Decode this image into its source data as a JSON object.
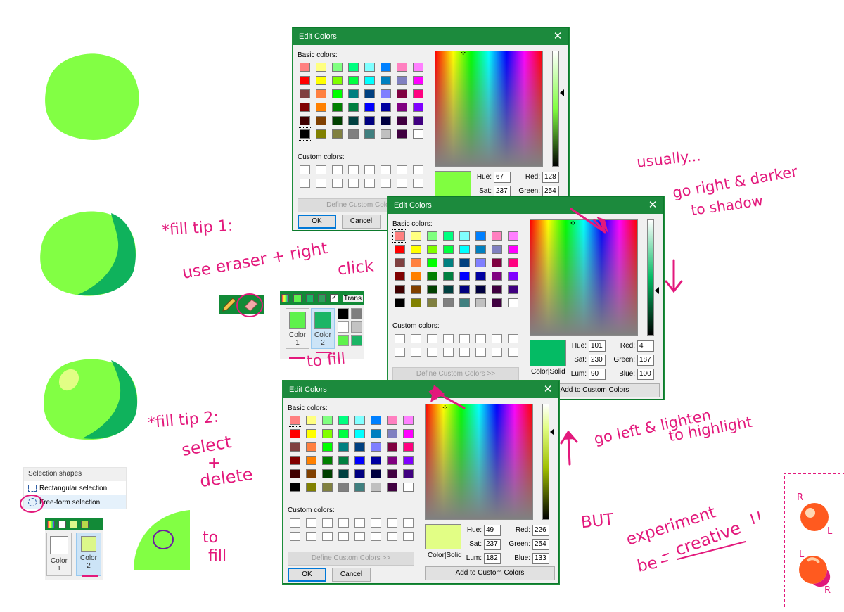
{
  "colors": {
    "basic": [
      "#ff8080",
      "#ffff80",
      "#80ff80",
      "#00ff80",
      "#80ffff",
      "#0080ff",
      "#ff80c0",
      "#ff80ff",
      "#ff0000",
      "#ffff00",
      "#80ff00",
      "#00ff40",
      "#00ffff",
      "#0080c0",
      "#8080c0",
      "#ff00ff",
      "#804040",
      "#ff8040",
      "#00ff00",
      "#008080",
      "#004080",
      "#8080ff",
      "#800040",
      "#ff0080",
      "#800000",
      "#ff8000",
      "#008000",
      "#008040",
      "#0000ff",
      "#0000a0",
      "#800080",
      "#8000ff",
      "#400000",
      "#804000",
      "#004000",
      "#004040",
      "#000080",
      "#000040",
      "#400040",
      "#400080",
      "#000000",
      "#808000",
      "#808040",
      "#808080",
      "#408080",
      "#c0c0c0",
      "#400040",
      "#ffffff"
    ]
  },
  "dialog1": {
    "title": "Edit Colors",
    "close": "✕",
    "basic_label": "Basic colors:",
    "custom_label": "Custom colors:",
    "define_btn": "Define Custom Colors",
    "ok": "OK",
    "cancel": "Cancel",
    "hue_label": "Hue:",
    "hue": "67",
    "sat_label": "Sat:",
    "sat": "237",
    "red_label": "Red:",
    "red": "128",
    "green_label": "Green:",
    "green": "254",
    "current_color": "#80fe40"
  },
  "dialog2": {
    "title": "Edit Colors",
    "close": "✕",
    "basic_label": "Basic colors:",
    "custom_label": "Custom colors:",
    "define_btn": "Define Custom Colors >>",
    "add_btn": "Add to Custom Colors",
    "hue_label": "Hue:",
    "hue": "101",
    "sat_label": "Sat:",
    "sat": "230",
    "lum_label": "Lum:",
    "lum": "90",
    "red_label": "Red:",
    "red": "4",
    "green_label": "Green:",
    "green": "187",
    "blue_label": "Blue:",
    "blue": "100",
    "color_solid": "Color|Solid",
    "current_color": "#04bb64"
  },
  "dialog3": {
    "title": "Edit Colors",
    "close": "✕",
    "basic_label": "Basic colors:",
    "custom_label": "Custom colors:",
    "define_btn": "Define Custom Colors >>",
    "add_btn": "Add to Custom Colors",
    "ok": "OK",
    "cancel": "Cancel",
    "hue_label": "Hue:",
    "hue": "49",
    "sat_label": "Sat:",
    "sat": "237",
    "lum_label": "Lum:",
    "lum": "182",
    "red_label": "Red:",
    "red": "226",
    "green_label": "Green:",
    "green": "254",
    "blue_label": "Blue:",
    "blue": "133",
    "color_solid": "Color|Solid",
    "current_color": "#e2fe85"
  },
  "palette_panel": {
    "transparent_label": "Trans",
    "color1_label": "Color 1",
    "color1_line1": "Color",
    "color1_line2": "1",
    "color2_line1": "Color",
    "color2_line2": "2",
    "color1": "#5ef24c",
    "color2": "#1bb565"
  },
  "selection_menu": {
    "title": "Selection shapes",
    "rect": "Rectangular selection",
    "freeform": "Free-form selection"
  },
  "palette_panel2": {
    "color1_line1": "Color",
    "color1_line2": "1",
    "color2_line1": "Color",
    "color2_line2": "2",
    "color1": "#ffffff",
    "color2": "#dcf78a"
  },
  "notes": {
    "tip1": "*fill tip 1:",
    "tip1_body_a": "use eraser + right",
    "tip1_body_b": "click",
    "to_fill1": "to fill",
    "tip2": "*fill tip 2:",
    "select": "select",
    "plus": "+",
    "delete": "delete",
    "to_fill2a": "to",
    "to_fill2b": "fill",
    "usually": "usually...",
    "go_right": "go right & darker",
    "to_shadow": "to shadow",
    "go_left": "go left & lighten",
    "to_highlight": "to highlight",
    "but": "BUT",
    "experiment": "experiment",
    "be": "be",
    "creative": "creative",
    "r1": "R",
    "l1": "L",
    "l2": "L",
    "r2": "R"
  }
}
